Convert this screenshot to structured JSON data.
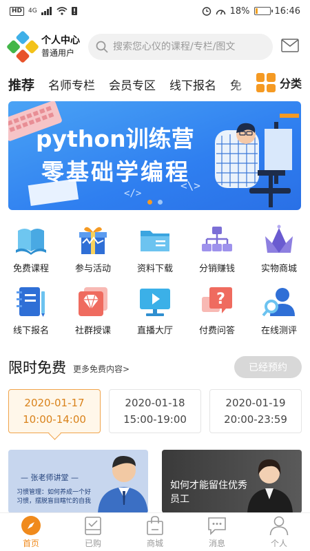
{
  "status_bar": {
    "network": "4G",
    "battery": "18%",
    "battery_level": 0.18,
    "time": "16:46"
  },
  "header": {
    "title": "个人中心",
    "subtitle": "普通用户",
    "search_placeholder": "搜索您心仪的课程/专栏/图文"
  },
  "tabs": [
    {
      "label": "推荐",
      "active": true
    },
    {
      "label": "名师专栏"
    },
    {
      "label": "会员专区"
    },
    {
      "label": "线下报名"
    },
    {
      "label": "免"
    }
  ],
  "category_label": "分类",
  "banner": {
    "line1": "python训练营",
    "line2": "零基础学编程",
    "pages": 2,
    "current_page": 1
  },
  "features": [
    {
      "label": "免费课程",
      "icon": "book-icon"
    },
    {
      "label": "参与活动",
      "icon": "gift-icon"
    },
    {
      "label": "资料下载",
      "icon": "folder-icon"
    },
    {
      "label": "分销赚钱",
      "icon": "hierarchy-icon"
    },
    {
      "label": "实物商城",
      "icon": "crown-icon"
    },
    {
      "label": "线下报名",
      "icon": "notebook-icon"
    },
    {
      "label": "社群授课",
      "icon": "diamond-icon"
    },
    {
      "label": "直播大厅",
      "icon": "play-screen-icon"
    },
    {
      "label": "付费问答",
      "icon": "question-icon"
    },
    {
      "label": "在线测评",
      "icon": "user-search-icon"
    }
  ],
  "limited": {
    "title": "限时免费",
    "more": "更多免费内容>",
    "reserved_button": "已经预约",
    "slots": [
      {
        "date": "2020-01-17",
        "time": "10:00-14:00",
        "active": true
      },
      {
        "date": "2020-01-18",
        "time": "15:00-19:00"
      },
      {
        "date": "2020-01-19",
        "time": "20:00-23:59"
      }
    ]
  },
  "cards": [
    {
      "teacher": "— 张老师讲堂 —",
      "desc": "习惯管理：如何养成一个好习惯，摆脱盲目瞎忙的自我"
    },
    {
      "title": "如何才能留住优秀员工"
    }
  ],
  "bottom_nav": [
    {
      "label": "首页",
      "icon": "compass-icon",
      "active": true
    },
    {
      "label": "已购",
      "icon": "purchased-icon"
    },
    {
      "label": "商城",
      "icon": "shopping-bag-icon"
    },
    {
      "label": "消息",
      "icon": "message-icon"
    },
    {
      "label": "个人",
      "icon": "person-icon"
    }
  ],
  "colors": {
    "accent": "#f59a23",
    "banner": "#2f7ff0",
    "active_nav": "#f08a1c"
  }
}
